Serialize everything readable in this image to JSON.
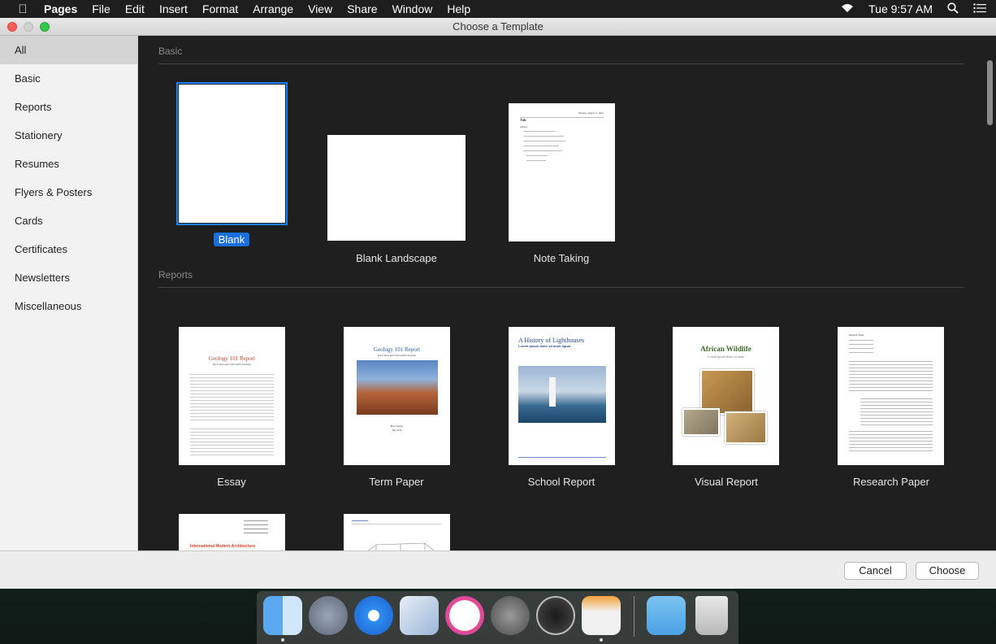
{
  "menubar": {
    "app": "Pages",
    "items": [
      "File",
      "Edit",
      "Insert",
      "Format",
      "Arrange",
      "View",
      "Share",
      "Window",
      "Help"
    ],
    "clock": "Tue 9:57 AM"
  },
  "window": {
    "title": "Choose a Template"
  },
  "sidebar": {
    "items": [
      {
        "label": "All",
        "selected": true
      },
      {
        "label": "Basic"
      },
      {
        "label": "Reports"
      },
      {
        "label": "Stationery"
      },
      {
        "label": "Resumes"
      },
      {
        "label": "Flyers & Posters"
      },
      {
        "label": "Cards"
      },
      {
        "label": "Certificates"
      },
      {
        "label": "Newsletters"
      },
      {
        "label": "Miscellaneous"
      }
    ]
  },
  "sections": {
    "basic": {
      "title": "Basic",
      "templates": [
        {
          "label": "Blank",
          "selected": true
        },
        {
          "label": "Blank Landscape"
        },
        {
          "label": "Note Taking",
          "page_title": "Title",
          "page_date": "Monday, August 11, 2014",
          "page_subtitle": "Subject"
        }
      ]
    },
    "reports": {
      "title": "Reports",
      "templates": [
        {
          "label": "Essay",
          "page_title": "Geology 101 Report",
          "page_subtitle": "Sed et lacus quis enim mattis nonummy"
        },
        {
          "label": "Term Paper",
          "page_title": "Geology 101 Report",
          "page_subtitle": "Sed et lacus quis enim mattis nonummy",
          "page_author": "Elisa Steeper",
          "page_date": "July 2014"
        },
        {
          "label": "School Report",
          "page_title": "A History of Lighthouses",
          "page_subtitle": "Lorem ipsum dolor sit amet ligula"
        },
        {
          "label": "Visual Report",
          "page_title": "African Wildlife",
          "page_subtitle": "Lorem ipsum dolor sit amet"
        },
        {
          "label": "Research Paper",
          "page_title": "Research Paper"
        }
      ],
      "row3": [
        {
          "page_title": "International Modern Architecture"
        },
        {
          "page_title": ""
        }
      ]
    }
  },
  "buttons": {
    "cancel": "Cancel",
    "choose": "Choose"
  },
  "colors": {
    "selection": "#1a82fb",
    "sidebar_selected": "#d4d4d4",
    "gallery_bg": "#1f1f1f"
  },
  "dock": {
    "icons": [
      "finder-icon",
      "launchpad-icon",
      "safari-icon",
      "mail-icon",
      "itunes-icon",
      "system-preferences-icon",
      "activity-monitor-icon",
      "pages-icon",
      "downloads-folder-icon",
      "trash-icon"
    ]
  }
}
